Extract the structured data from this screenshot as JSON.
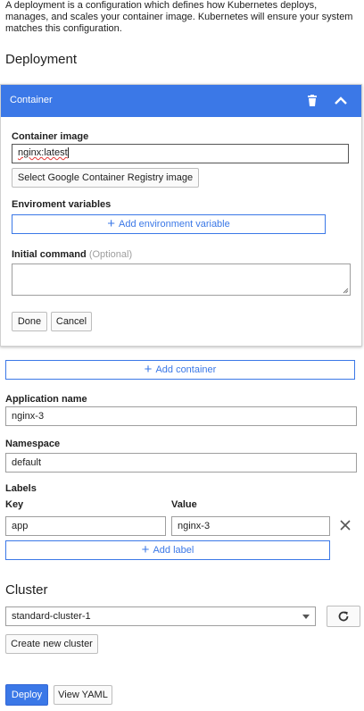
{
  "intro_text": "A deployment is a configuration which defines how Kubernetes deploys, manages, and scales your container image. Kubernetes will ensure your system matches this configuration.",
  "deployment_title": "Deployment",
  "container": {
    "header_title": "Container",
    "container_image_label": "Container image",
    "container_image_value": "nginx:latest",
    "select_registry_label": "Select Google Container Registry image",
    "env_label": "Enviroment variables",
    "add_env_label": "Add environment variable",
    "initial_command_label": "Initial command",
    "initial_command_optional": "(Optional)",
    "initial_command_value": "",
    "done_label": "Done",
    "cancel_label": "Cancel"
  },
  "add_container_label": "Add container",
  "application_name": {
    "label": "Application name",
    "value": "nginx-3"
  },
  "namespace": {
    "label": "Namespace",
    "value": "default"
  },
  "labels": {
    "title": "Labels",
    "key_header": "Key",
    "value_header": "Value",
    "rows": [
      {
        "key": "app",
        "value": "nginx-3"
      }
    ],
    "add_label": "Add label"
  },
  "cluster": {
    "title": "Cluster",
    "selected": "standard-cluster-1",
    "create_new_label": "Create new cluster"
  },
  "actions": {
    "deploy_label": "Deploy",
    "view_yaml_label": "View YAML"
  },
  "icons": {
    "trash": "trash-icon",
    "collapse": "chevron-up-icon",
    "plus": "plus-icon",
    "remove": "close-icon",
    "refresh": "refresh-icon",
    "dropdown": "chevron-down-icon"
  },
  "colors": {
    "accent": "#3b78e7"
  }
}
